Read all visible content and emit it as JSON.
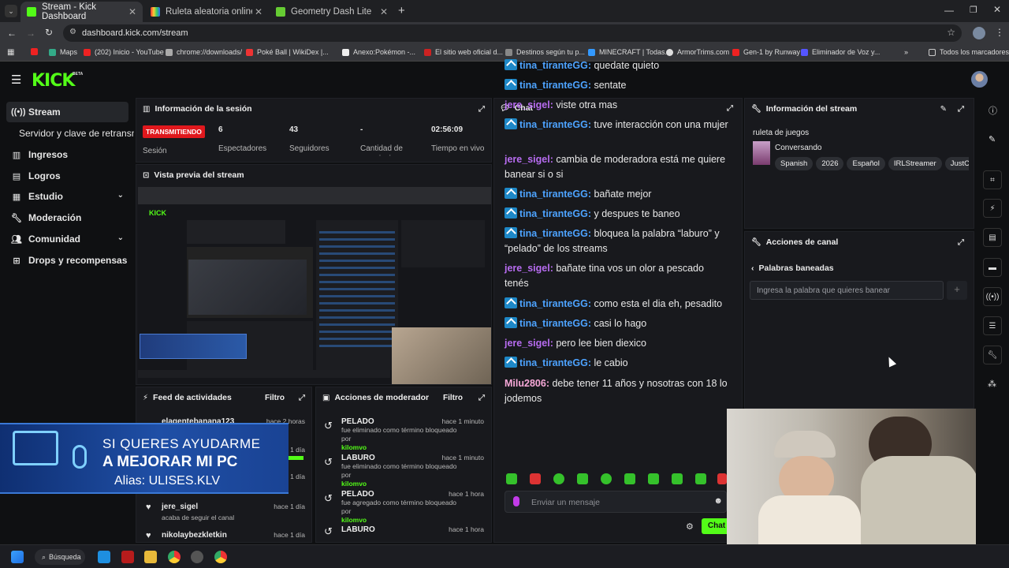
{
  "browser": {
    "tabs": [
      {
        "title": "Stream - Kick Dashboard",
        "active": true
      },
      {
        "title": "Ruleta aleatoria online – ruleta",
        "active": false
      },
      {
        "title": "Geometry Dash Lite",
        "active": false
      }
    ],
    "url": "dashboard.kick.com/stream",
    "bookmarks": [
      "Maps",
      "(202) Inicio - YouTube",
      "chrome://downloads/",
      "Poké Ball | WikiDex |...",
      "Anexo:Pokémon -...",
      "El sitio web oficial d...",
      "Destinos según tu p...",
      "MINECRAFT | Todas...",
      "ArmorTrims.com",
      "Gen-1 by Runway",
      "Eliminador de Voz y...",
      "Todos los marcadores"
    ]
  },
  "app": {
    "logo": "KICK",
    "logo_badge": "BETA"
  },
  "sidebar": {
    "items": [
      {
        "label": "Stream",
        "icon": "broadcast-icon",
        "active": true
      },
      {
        "label": "Servidor y clave de retransmisión",
        "icon": "",
        "active": false
      },
      {
        "label": "Ingresos",
        "icon": "chart-icon",
        "active": false
      },
      {
        "label": "Logros",
        "icon": "trophy-icon",
        "active": false
      },
      {
        "label": "Estudio",
        "icon": "studio-icon",
        "active": false,
        "expand": true
      },
      {
        "label": "Moderación",
        "icon": "wrench-icon",
        "active": false
      },
      {
        "label": "Comunidad",
        "icon": "people-icon",
        "active": false,
        "expand": true
      },
      {
        "label": "Drops y recompensas",
        "icon": "gift-icon",
        "active": false
      }
    ]
  },
  "session": {
    "title": "Información de la sesión",
    "status": "TRANSMITIENDO",
    "status_label": "Sesión",
    "stats": [
      {
        "value": "6",
        "label": "Espectadores"
      },
      {
        "value": "43",
        "label": "Seguidores"
      },
      {
        "value": "-",
        "label": "Cantidad de suscripciones"
      },
      {
        "value": "02:56:09",
        "label": "Tiempo en vivo"
      }
    ]
  },
  "preview": {
    "title": "Vista previa del stream"
  },
  "overlay_banner": {
    "line1": "SI QUERES AYUDARME",
    "line2": "A MEJORAR MI PC",
    "line3": "Alias: ULISES.KLV"
  },
  "feed": {
    "title": "Feed de actividades",
    "filter": "Filtro",
    "items": [
      {
        "user": "elagentebanana123",
        "time": "hace 2 horas",
        "desc": ""
      },
      {
        "user": "jere_sigel",
        "time": "hace 1 día",
        "desc": "acaba de seguir el canal"
      },
      {
        "user": "nikolaybezkletkin",
        "time": "hace 1 día",
        "desc": ""
      }
    ],
    "hidden_times": [
      "hace 1 día",
      "hace 1 día"
    ]
  },
  "modactions": {
    "title": "Acciones de moderador",
    "filter": "Filtro",
    "items": [
      {
        "word": "PELADO",
        "time": "hace 1 minuto",
        "desc": "fue eliminado como término bloqueado por",
        "by": "kilomvo"
      },
      {
        "word": "LABURO",
        "time": "hace 1 minuto",
        "desc": "fue eliminado como término bloqueado por",
        "by": "kilomvo"
      },
      {
        "word": "PELADO",
        "time": "hace 1 hora",
        "desc": "fue agregado como término bloqueado por",
        "by": "kilomvo"
      },
      {
        "word": "LABURO",
        "time": "hace 1 hora",
        "desc": "",
        "by": ""
      }
    ]
  },
  "chat": {
    "title": "Chat",
    "messages": [
      {
        "user": "tina_tiranteGG",
        "role": "tina",
        "text": "quedate quieto"
      },
      {
        "user": "tina_tiranteGG",
        "role": "tina",
        "text": "sentate"
      },
      {
        "user": "jere_sigel",
        "role": "jere",
        "text": "viste otra mas"
      },
      {
        "user": "tina_tiranteGG",
        "role": "tina",
        "text": "tuve interacción con una mujer"
      },
      {
        "user": "jere_sigel",
        "role": "jere",
        "text": "cambia de moderadora está me quiere banear si o si"
      },
      {
        "user": "tina_tiranteGG",
        "role": "tina",
        "text": "bañate mejor"
      },
      {
        "user": "tina_tiranteGG",
        "role": "tina",
        "text": "y despues te baneo"
      },
      {
        "user": "tina_tiranteGG",
        "role": "tina",
        "text": "bloquea la palabra “laburo” y “pelado” de los streams"
      },
      {
        "user": "jere_sigel",
        "role": "jere",
        "text": "bañate tina vos un olor a pescado tenés"
      },
      {
        "user": "tina_tiranteGG",
        "role": "tina",
        "text": "como esta el dia eh, pesadito"
      },
      {
        "user": "tina_tiranteGG",
        "role": "tina",
        "text": "casi lo hago"
      },
      {
        "user": "jere_sigel",
        "role": "jere",
        "text": "pero lee bien diexico"
      },
      {
        "user": "tina_tiranteGG",
        "role": "tina",
        "text": "le cabio"
      },
      {
        "user": "Milu2806",
        "role": "milu",
        "text": "debe tener 11 años y nosotras con 18 lo jodemos"
      }
    ],
    "input_placeholder": "Enviar un mensaje",
    "send_label": "Chat"
  },
  "stream_info": {
    "title": "Información del stream",
    "stream_title": "ruleta de juegos",
    "category": "Conversando",
    "tags": [
      "Spanish",
      "2026",
      "Español",
      "IRLStreamer",
      "JustC"
    ]
  },
  "channel_actions": {
    "title": "Acciones de canal",
    "section": "Palabras baneadas",
    "input_placeholder": "Ingresa la palabra que quieres banear",
    "add_label": "+"
  },
  "taskbar": {
    "search": "Búsqueda"
  },
  "colors": {
    "kick_green": "#53fc18",
    "live_red": "#e0181d",
    "tina": "#4da3ff",
    "jere": "#b76cf0",
    "milu": "#f7a8d8"
  }
}
